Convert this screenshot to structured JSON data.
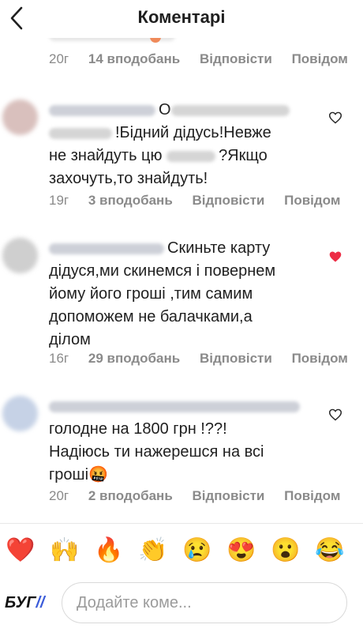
{
  "header": {
    "title": "Коментарі",
    "back_icon": "chevron-left-icon"
  },
  "top_meta": {
    "time": "20г",
    "likes": "14 вподобань",
    "reply": "Відповісти",
    "more": "Повідом"
  },
  "comments": [
    {
      "text_visible": [
        "О",
        "!Бідний дідусь!Невже",
        "не знайдуть цю",
        "?Якщо",
        "захочуть,то знайдуть!"
      ],
      "time": "19г",
      "likes": "3 вподобань",
      "reply": "Відповісти",
      "more": "Повідом",
      "liked": false,
      "avatar_color": "#d9c0bd"
    },
    {
      "text_visible": [
        "Скиньте карту",
        "дідуся,ми скинемся і повернем",
        "йому його гроші ,тим самим",
        "допоможем не балачками,а",
        "ділом"
      ],
      "time": "16г",
      "likes": "29 вподобань",
      "reply": "Відповісти",
      "more": "Повідом",
      "liked": true,
      "avatar_color": "#cfcfcf"
    },
    {
      "text_visible": [
        "голодне на 1800 грн !??!",
        "Надіюсь ти нажерешся на всі",
        "гроші",
        "🤬"
      ],
      "time": "20г",
      "likes": "2 вподобань",
      "reply": "Відповісти",
      "more": "Повідом",
      "liked": false,
      "avatar_color": "#c6d2e6"
    }
  ],
  "emoji_bar": [
    "❤️",
    "🙌",
    "🔥",
    "👏",
    "😢",
    "😍",
    "😮",
    "😂"
  ],
  "composer": {
    "logo_text": "БУГ",
    "logo_slash": "//",
    "placeholder": "Додайте коме..."
  },
  "colors": {
    "liked_heart": "#ed2d46",
    "meta_text": "#8a8a8a",
    "accent": "#3a5bd9"
  }
}
